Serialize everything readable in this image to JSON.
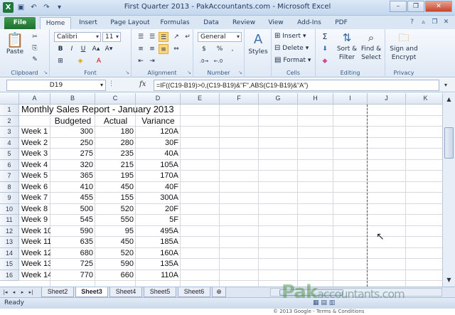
{
  "window": {
    "title": "First Quarter 2013 - PakAccountants.com - Microsoft Excel",
    "app_icon": "X"
  },
  "ribbon_tabs": [
    "File",
    "Home",
    "Insert",
    "Page Layout",
    "Formulas",
    "Data",
    "Review",
    "View",
    "Add-Ins",
    "PDF"
  ],
  "active_tab": "Home",
  "clipboard": {
    "paste": "Paste",
    "label": "Clipboard"
  },
  "font": {
    "name": "Calibri",
    "size": "11",
    "bold": "B",
    "italic": "I",
    "underline": "U",
    "label": "Font"
  },
  "alignment": {
    "label": "Alignment"
  },
  "number": {
    "format": "General",
    "currency": "$",
    "percent": "%",
    "comma": ",",
    "label": "Number"
  },
  "styles": {
    "label": "Styles"
  },
  "cells": {
    "insert": "Insert",
    "delete": "Delete",
    "format": "Format",
    "label": "Cells"
  },
  "editing": {
    "sum": "Σ",
    "sort": "Sort &",
    "sort2": "Filter",
    "find": "Find &",
    "find2": "Select",
    "label": "Editing"
  },
  "privacy": {
    "sign": "Sign and",
    "sign2": "Encrypt",
    "label": "Privacy"
  },
  "formula_bar": {
    "name_box": "D19",
    "fx": "fx",
    "formula": "=IF((C19-B19)>0,(C19-B19)&\"F\",ABS(C19-B19)&\"A\")"
  },
  "columns": [
    "A",
    "B",
    "C",
    "D",
    "E",
    "F",
    "G",
    "H",
    "I",
    "J",
    "K"
  ],
  "rows": [
    "1",
    "2",
    "3",
    "4",
    "5",
    "6",
    "7",
    "8",
    "9",
    "10",
    "11",
    "12",
    "13",
    "14",
    "15",
    "16"
  ],
  "sheet": {
    "title": "Monthly Sales Report - January 2013",
    "headers": [
      "Budgeted",
      "Actual",
      "Variance"
    ],
    "data": [
      [
        "Week 1",
        "300",
        "180",
        "120A"
      ],
      [
        "Week 2",
        "250",
        "280",
        "30F"
      ],
      [
        "Week 3",
        "275",
        "235",
        "40A"
      ],
      [
        "Week 4",
        "320",
        "215",
        "105A"
      ],
      [
        "Week 5",
        "365",
        "195",
        "170A"
      ],
      [
        "Week 6",
        "410",
        "450",
        "40F"
      ],
      [
        "Week 7",
        "455",
        "155",
        "300A"
      ],
      [
        "Week 8",
        "500",
        "520",
        "20F"
      ],
      [
        "Week 9",
        "545",
        "550",
        "5F"
      ],
      [
        "Week 10",
        "590",
        "95",
        "495A"
      ],
      [
        "Week 11",
        "635",
        "450",
        "185A"
      ],
      [
        "Week 12",
        "680",
        "520",
        "160A"
      ],
      [
        "Week 13",
        "725",
        "590",
        "135A"
      ],
      [
        "Week 14",
        "770",
        "660",
        "110A"
      ]
    ]
  },
  "sheet_tabs": [
    "Sheet2",
    "Sheet3",
    "Sheet4",
    "Sheet5",
    "Sheet6"
  ],
  "active_sheet": "Sheet3",
  "status": {
    "ready": "Ready"
  },
  "watermark": {
    "brand": "Pak",
    "brand_rest": "accountants.com",
    "copyright": "© 2013 Google - Terms & Conditions"
  }
}
